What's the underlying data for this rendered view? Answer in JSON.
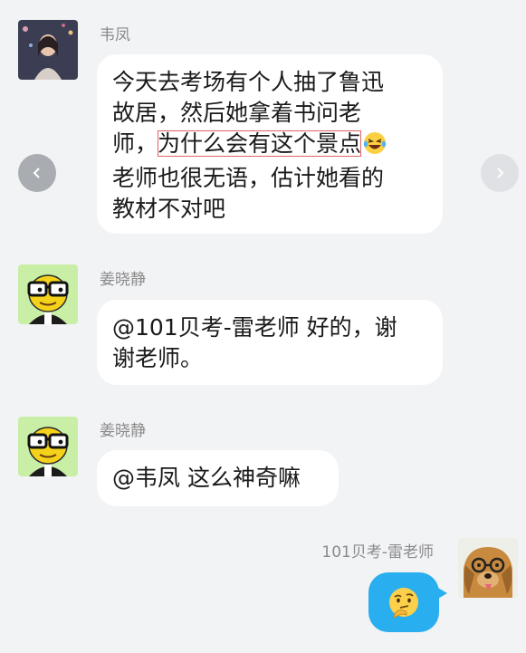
{
  "messages": [
    {
      "sender": "韦凤",
      "lines": [
        "今天去考场有个人抽了鲁迅",
        "故居，然后她拿着书问老",
        "师，",
        "为什么会有这个景点",
        "老师也很无语，估计她看的",
        "教材不对吧"
      ],
      "emoji": "laughing-tears-emoji"
    },
    {
      "sender": "姜晓静",
      "lines": [
        "@101贝考-雷老师 好的，谢",
        "谢老师。"
      ]
    },
    {
      "sender": "姜晓静",
      "lines": [
        "@韦凤 这么神奇嘛"
      ]
    },
    {
      "sender": "101贝考-雷老师",
      "emoji": "thinking-face-emoji"
    }
  ],
  "nav": {
    "prev_icon": "chevron-left-icon",
    "next_icon": "chevron-right-icon"
  },
  "colors": {
    "background": "#f2f3f5",
    "bubble_other": "#ffffff",
    "bubble_self": "#29aff0",
    "highlight_border": "#e0626a"
  }
}
